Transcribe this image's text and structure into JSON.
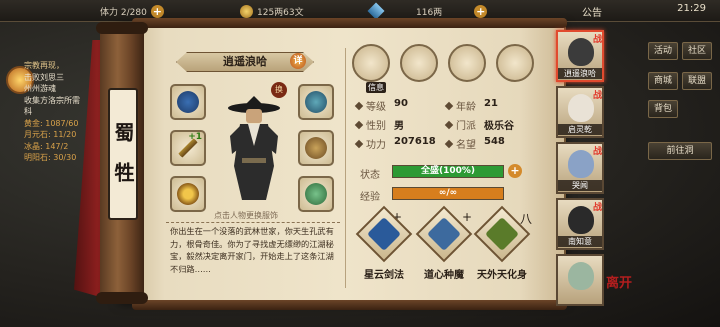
{
  "topbar": {
    "stamina": "体力 2/280",
    "silver": "125两63文",
    "gold": "116两",
    "notice": "公告",
    "time": "21:29"
  },
  "quest": {
    "title": "宗教再现，",
    "lines": [
      "击败刘思三",
      "州州游魂",
      "收集方洛宗所需",
      "科"
    ],
    "stats": [
      "黄金: 1087/60",
      "月元石: 11/20",
      "冰晶: 147/2",
      "明阳石: 30/30"
    ]
  },
  "side_buttons": [
    "活动",
    "社区",
    "商城",
    "联盟",
    "背包",
    "前往洞"
  ],
  "sect": "蜀牲",
  "character": {
    "name": "逍遥浪哈",
    "detail_btn": "详",
    "swap_icon": "换",
    "swap_hint": "点击人物更换服饰",
    "slot_enhance": "+1",
    "stats": {
      "level_label": "等级",
      "level": "90",
      "age_label": "年龄",
      "age": "21",
      "gender_label": "性别",
      "gender": "男",
      "school_label": "门派",
      "school": "极乐谷",
      "power_label": "功力",
      "power": "207618",
      "fame_label": "名望",
      "fame": "548"
    },
    "status_label": "状态",
    "status_text": "全盛(100%)",
    "status_value": 1.0,
    "exp_label": "经验",
    "exp_text": "∞/∞",
    "exp_value": 1.0,
    "bio": "你出生在一个没落的武林世家，你天生孔武有力，根骨奇佳。你为了寻找虚无缥缈的江湖秘宝，毅然决定离开家门，开始走上了这条江湖不归路……"
  },
  "skills": [
    {
      "name": "星云剑法",
      "mark": "+",
      "color": "#2a5a9a"
    },
    {
      "name": "道心种魔",
      "mark": "+",
      "color": "#3d6a9e"
    },
    {
      "name": "天外天化身",
      "mark": "八",
      "color": "#5a7b2a"
    }
  ],
  "top_icons": [
    "信息",
    "",
    "",
    ""
  ],
  "roster": [
    {
      "name": "逍遥浪哈",
      "active": true,
      "mark": "战",
      "face": "#3b3b3b"
    },
    {
      "name": "启灵乾",
      "active": false,
      "mark": "战",
      "face": "#e9e2d6"
    },
    {
      "name": "哭闻",
      "active": false,
      "mark": "战",
      "face": "#8aa2c6"
    },
    {
      "name": "南知意",
      "active": false,
      "mark": "战",
      "face": "#2a2a2a"
    },
    {
      "name": "",
      "active": false,
      "mark": "",
      "face": "#9bb6a0"
    }
  ],
  "roster_tag": "离开",
  "colors": {
    "status_fill": "#2d9a34",
    "exp_fill": "#d77e1d",
    "accent": "#e14a2e"
  }
}
